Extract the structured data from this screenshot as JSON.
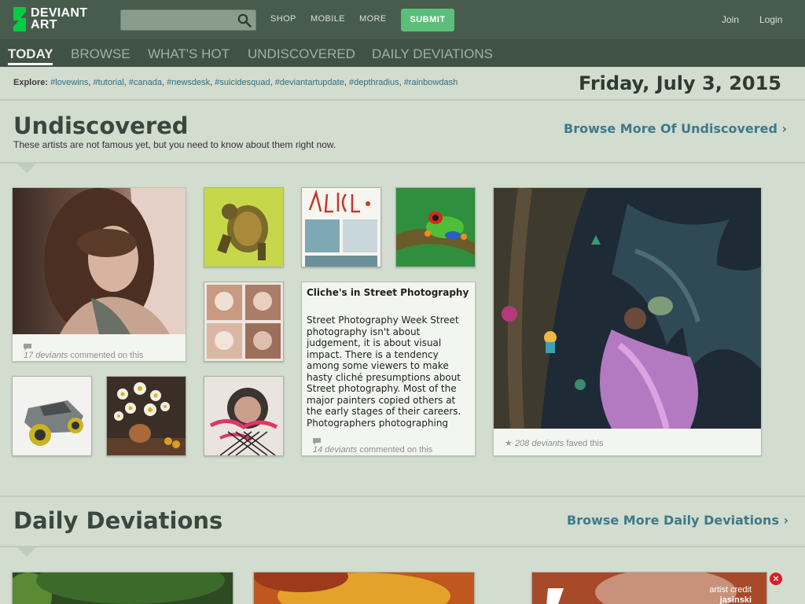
{
  "brand": {
    "line1": "DEVIANT",
    "line2": "ART"
  },
  "search": {
    "placeholder": ""
  },
  "topnav": {
    "shop": "SHOP",
    "mobile": "MOBILE",
    "more": "MORE",
    "submit": "SUBMIT",
    "join": "Join",
    "login": "Login"
  },
  "tabs": [
    {
      "label": "TODAY"
    },
    {
      "label": "BROWSE"
    },
    {
      "label": "WHAT'S HOT"
    },
    {
      "label": "UNDISCOVERED"
    },
    {
      "label": "DAILY DEVIATIONS"
    }
  ],
  "explore": {
    "label": "Explore:",
    "tags": [
      "#lovewins",
      "#tutorial",
      "#canada",
      "#newsdesk",
      "#suicidesquad",
      "#deviantartupdate",
      "#depthradius",
      "#rainbowdash"
    ]
  },
  "date": "Friday, July 3, 2015",
  "undiscovered": {
    "title": "Undiscovered",
    "subtitle": "These artists are not famous yet, but you need to know about them right now.",
    "browse_more": "Browse More Of Undiscovered",
    "portrait_meta": {
      "count": "17 deviants",
      "suffix": " commented on this"
    },
    "text_card": {
      "title": "Cliche's in Street Photography",
      "body": "Street Photography Week Street photography isn't about judgement, it is about visual impact. There is a tendency among some viewers to make hasty cliché presumptions about Street photography.  Most of the major painters copied others at the early stages of their careers. Photographers photographing",
      "meta_count": "14 deviants",
      "meta_suffix": " commented on this"
    },
    "featured_meta": {
      "count": "208 deviants",
      "suffix": " faved this"
    }
  },
  "daily": {
    "title": "Daily Deviations",
    "browse_more": "Browse More Daily Deviations",
    "credit_label": "artist credit",
    "credit_name": "jasinski",
    "close": "×"
  },
  "colors": {
    "topbar": "#475c4d",
    "tabbar": "#3f5244",
    "submit": "#5bbf7a",
    "link": "#3d7a8a",
    "page": "#d2dccf"
  }
}
